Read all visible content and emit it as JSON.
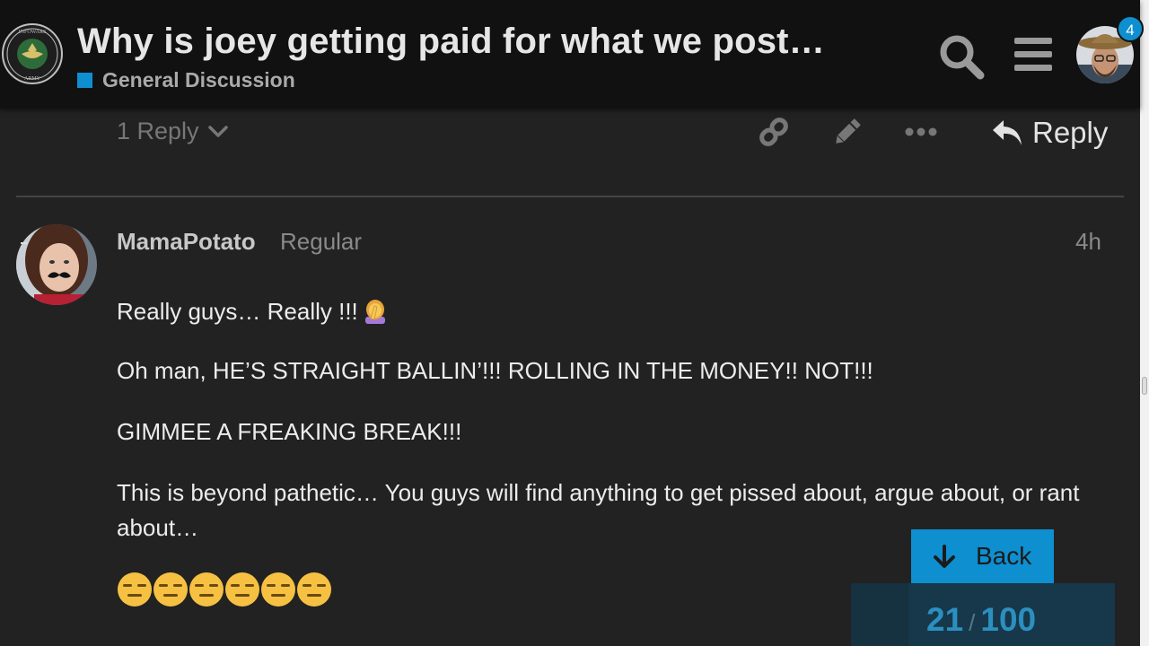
{
  "header": {
    "title": "Why is joey getting paid for what we post…",
    "category": "General Discussion",
    "category_color": "#0e8fd0",
    "logo_text_top": "INFOWARS",
    "logo_text_bottom": "ARMY",
    "notification_count": "4",
    "icons": [
      "search-icon",
      "hamburger-menu-icon"
    ]
  },
  "post_actions": {
    "replies_label": "1 Reply",
    "reply_label": "Reply",
    "icons": [
      "link-icon",
      "pencil-icon",
      "more-icon",
      "reply-arrow-icon"
    ]
  },
  "post": {
    "username": "MamaPotato",
    "user_title": "Regular",
    "date": "4h",
    "paragraphs": [
      "Really guys… Really !!!",
      "Oh man, HE’S STRAIGHT BALLIN’!!! ROLLING IN THE MONEY!! NOT!!!",
      "GIMMEE A FREAKING BREAK!!!",
      "This is beyond pathetic… You guys will find anything to get pissed about, argue about, or rant about…"
    ],
    "inline_emoji": "woman-facepalming",
    "emoji_row": [
      "expressionless",
      "expressionless",
      "expressionless",
      "expressionless",
      "expressionless",
      "expressionless"
    ]
  },
  "timeline": {
    "back_label": "Back",
    "current": "21",
    "separator": "/",
    "total": "100",
    "accent": "#0e8fd0"
  }
}
